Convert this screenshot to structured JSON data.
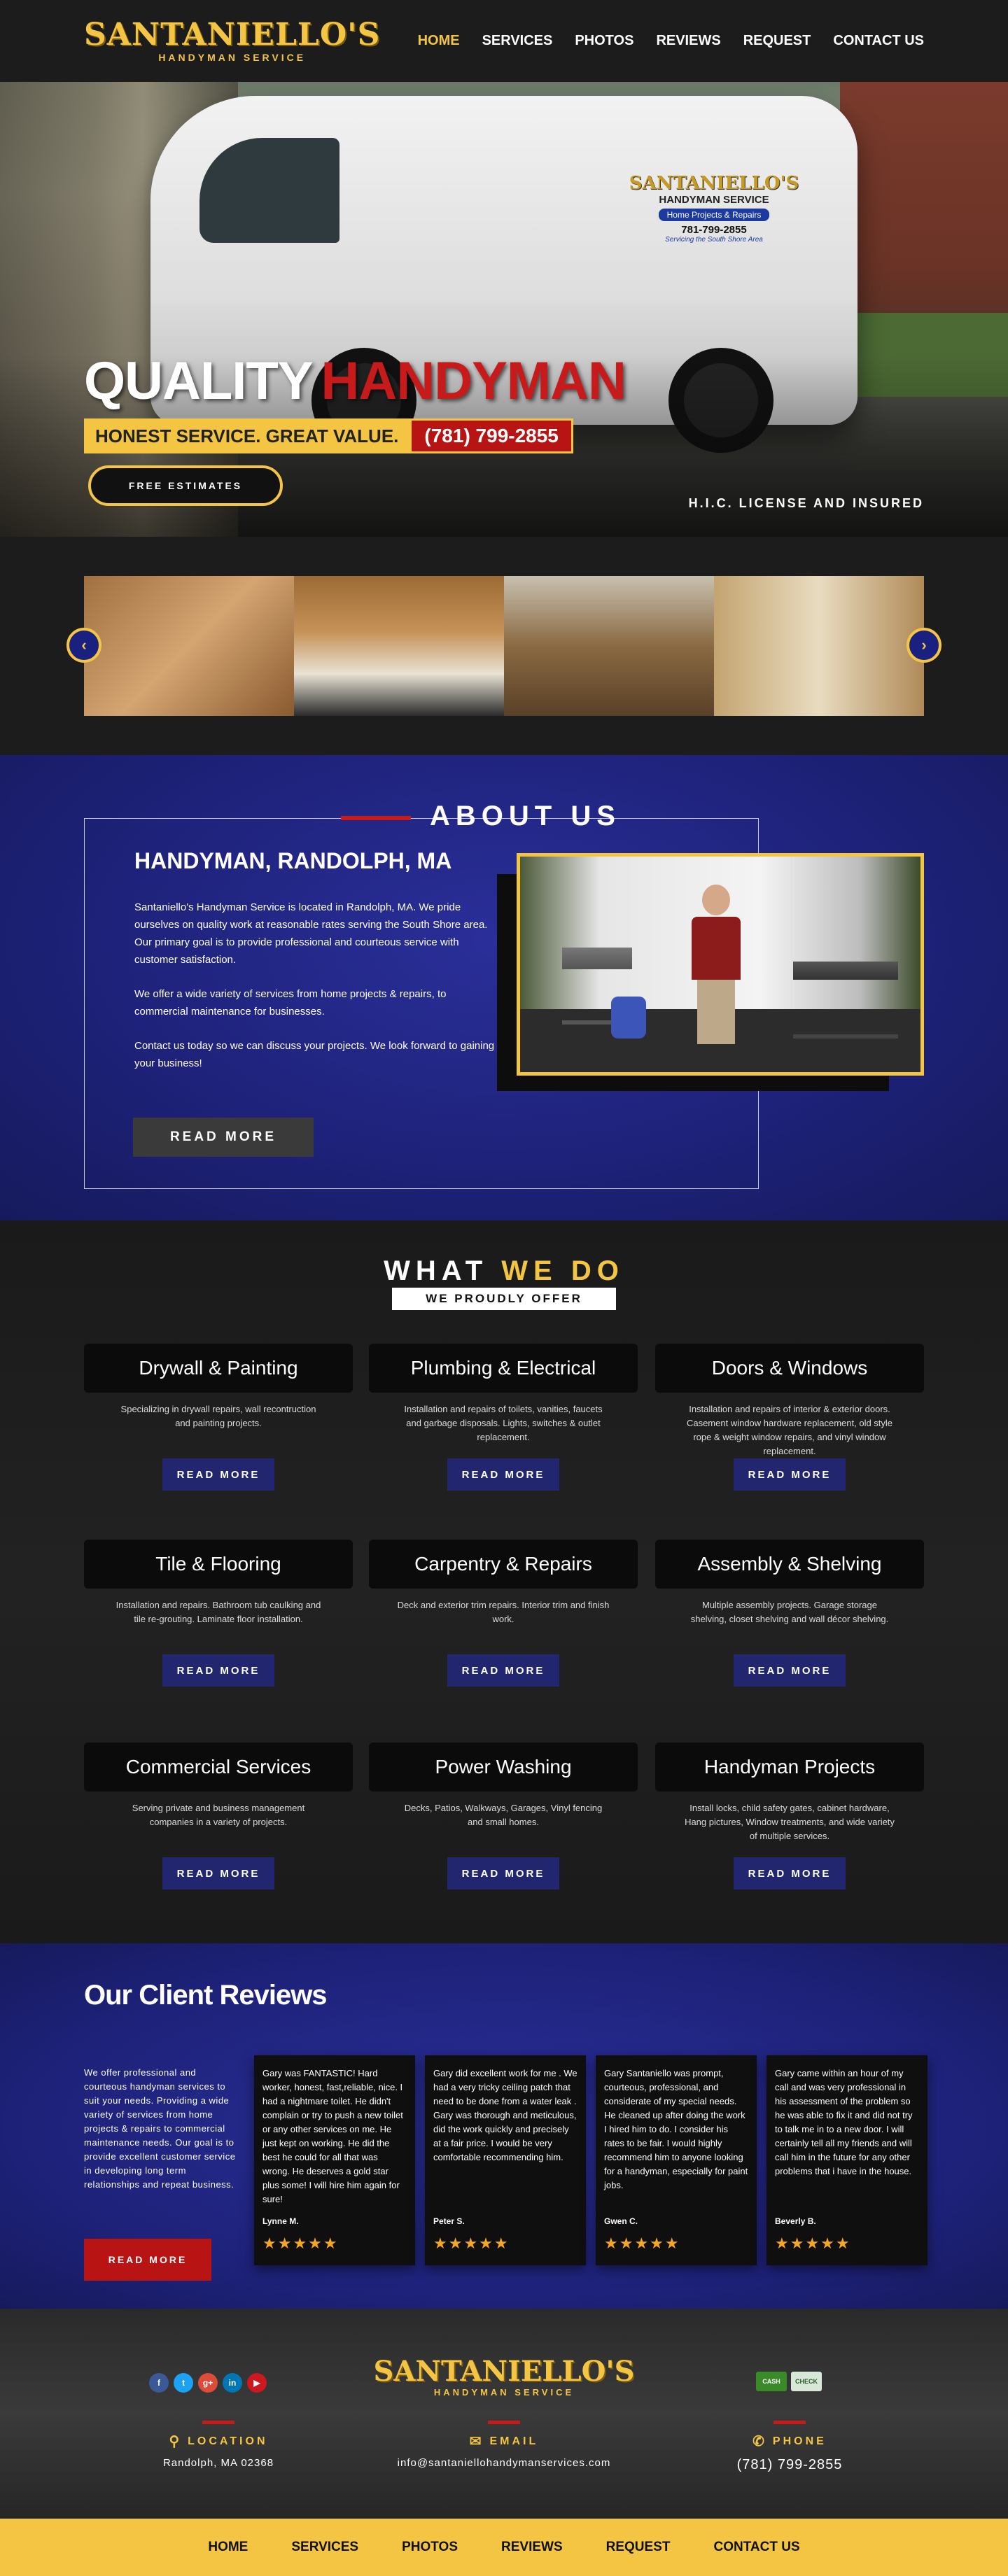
{
  "brand": {
    "name": "SANTANIELLO'S",
    "tagline": "HANDYMAN SERVICE",
    "accent": "#f3c543",
    "red": "#c71a1a",
    "navy": "#1d2177"
  },
  "nav": [
    {
      "label": "HOME"
    },
    {
      "label": "SERVICES"
    },
    {
      "label": "PHOTOS"
    },
    {
      "label": "REVIEWS"
    },
    {
      "label": "REQUEST"
    },
    {
      "label": "CONTACT US"
    }
  ],
  "hero": {
    "title_white": "QUALITY",
    "title_red": "HANDYMAN",
    "tagline": "HONEST SERVICE. GREAT VALUE.",
    "phone": "(781) 799-2855",
    "button": "FREE ESTIMATES",
    "license": "H.I.C. LICENSE AND INSURED",
    "van_decal": {
      "name": "SANTANIELLO'S",
      "service": "HANDYMAN SERVICE",
      "sub": "Home Projects & Repairs",
      "phone": "781-799-2855",
      "slogan": "Servicing the South Shore Area"
    }
  },
  "gallery": {
    "prev_icon": "chevron-left-icon",
    "next_icon": "chevron-right-icon"
  },
  "about": {
    "heading": "ABOUT US",
    "subheading": "HANDYMAN, RANDOLPH, MA",
    "paragraphs": [
      "Santaniello's Handyman Service is located in Randolph, MA. We pride ourselves on quality work at reasonable rates serving the South Shore area. Our primary goal is to provide professional and courteous service with customer satisfaction.",
      "We offer a wide variety of services from home projects & repairs, to commercial maintenance for businesses.",
      "Contact us today so we can discuss your projects. We look forward to gaining your business!"
    ],
    "button": "READ MORE"
  },
  "services": {
    "title_white": "WHAT",
    "title_yellow": "WE DO",
    "subtitle": "WE PROUDLY OFFER",
    "button": "READ MORE",
    "items": [
      {
        "title": "Drywall & Painting",
        "desc": "Specializing in drywall repairs, wall recontruction and painting projects."
      },
      {
        "title": "Plumbing & Electrical",
        "desc": "Installation and repairs of toilets, vanities, faucets and garbage disposals. Lights, switches & outlet replacement."
      },
      {
        "title": "Doors & Windows",
        "desc": "Installation and repairs of interior & exterior doors. Casement window hardware replacement, old style rope & weight window repairs, and vinyl window replacement."
      },
      {
        "title": "Tile & Flooring",
        "desc": "Installation and repairs. Bathroom tub caulking and tile re-grouting. Laminate floor installation."
      },
      {
        "title": "Carpentry & Repairs",
        "desc": "Deck and exterior trim repairs. Interior trim and finish work."
      },
      {
        "title": "Assembly & Shelving",
        "desc": "Multiple assembly projects. Garage storage shelving, closet shelving and wall décor shelving."
      },
      {
        "title": "Commercial Services",
        "desc": "Serving private and business management companies in a variety of projects."
      },
      {
        "title": "Power Washing",
        "desc": "Decks, Patios, Walkways, Garages, Vinyl fencing and small homes."
      },
      {
        "title": "Handyman Projects",
        "desc": "Install locks, child safety gates, cabinet hardware, Hang pictures, Window treatments, and wide variety of multiple services."
      }
    ]
  },
  "reviews": {
    "title": "Our Client Reviews",
    "intro": "We offer professional and courteous handyman services to suit your needs. Providing a wide variety of services from home projects & repairs to commercial maintenance needs. Our goal is to provide excellent customer service in developing long term relationships and repeat business.",
    "button": "READ MORE",
    "stars": "★★★★★",
    "items": [
      {
        "text": "Gary was FANTASTIC! Hard worker, honest, fast,reliable, nice. I had a nightmare toilet. He didn't complain or try to push a new toilet or any other services on me. He just kept on working. He did the best he could for all that was wrong. He deserves a gold star plus some! I will hire him again for sure!",
        "author": "Lynne M."
      },
      {
        "text": "Gary did excellent work for me . We had a very tricky ceiling patch that need to be done from a water leak . Gary was thorough and meticulous, did the work quickly and precisely at a fair price. I would be very comfortable recommending him.",
        "author": "Peter S."
      },
      {
        "text": "Gary Santaniello was prompt, courteous, professional, and considerate of my special needs. He cleaned up after doing the work I hired him to do. I consider his rates to be fair. I would highly recommend him to anyone looking for a handyman, especially for paint jobs.",
        "author": "Gwen C."
      },
      {
        "text": "Gary came within an hour of my call and was very professional in his assessment of the problem so he was able to fix it and did not try to talk me in to a new door. I will certainly tell all my friends and will call him in the future for any other problems that i have in the house.",
        "author": "Beverly B."
      }
    ]
  },
  "footer": {
    "social": [
      "f",
      "t",
      "g+",
      "in",
      "▶"
    ],
    "payments": [
      "CASH",
      "CHECK"
    ],
    "location_label": "LOCATION",
    "location": "Randolph, MA 02368",
    "email_label": "EMAIL",
    "email": "info@santaniellohandymanservices.com",
    "phone_label": "PHONE",
    "phone": "(781) 799-2855"
  }
}
